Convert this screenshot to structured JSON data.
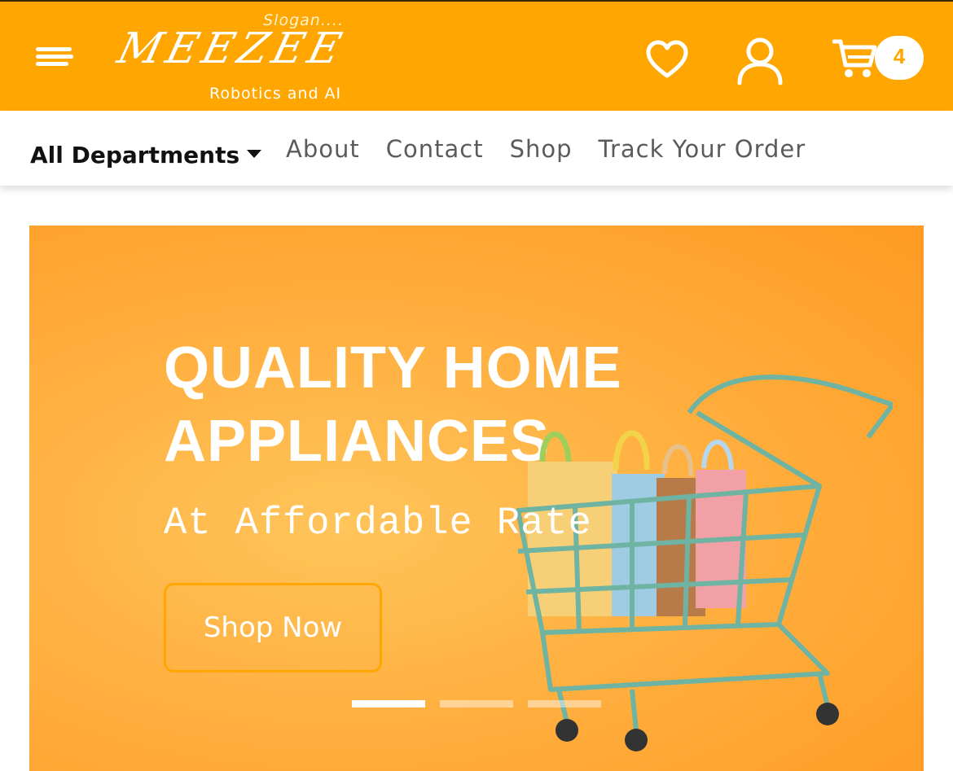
{
  "header": {
    "brand": {
      "slogan": "Slogan....",
      "logo": "MEEZEE",
      "tagline": "Robotics and AI"
    },
    "icons": [
      "menu-icon",
      "heart-icon",
      "user-icon",
      "cart-icon"
    ],
    "cart_count": "4",
    "colors": {
      "accent": "#ffa600",
      "text_on_accent": "#ffffff"
    }
  },
  "nav": {
    "departments_label": "All Departments",
    "links": [
      "About",
      "Contact",
      "Shop",
      "Track Your Order"
    ]
  },
  "hero": {
    "title_line1": "QUALITY HOME",
    "title_line2": "APPLIANCES",
    "subtitle": "At Affordable Rate",
    "cta": "Shop Now",
    "slides": 3,
    "active_slide": 1,
    "colors": {
      "background": "#ffb040",
      "cart": "#6fb3a2",
      "button_border": "#ffa600"
    }
  }
}
